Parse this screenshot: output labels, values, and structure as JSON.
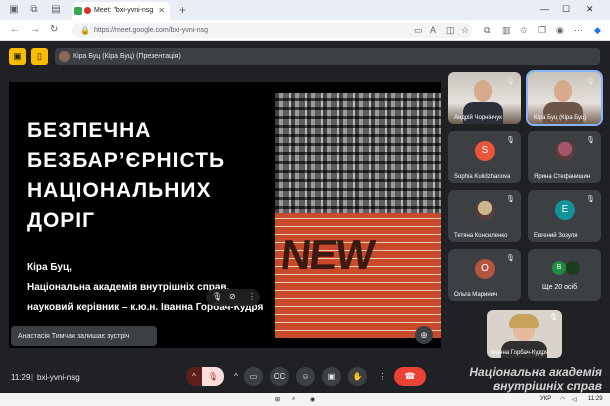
{
  "browser": {
    "tab_title": "Meet: \"bxi-yvni-nsg",
    "url": "https://meet.google.com/bxi-yvni-nsg"
  },
  "meet": {
    "presenter_label": "Кіра Буц (Кіра Буц) (Презентація)",
    "slide": {
      "title": "БЕЗПЕЧНА\nБЕЗБАР’ЄРНІСТЬ\nНАЦІОНАЛЬНИХ\nДОРІГ",
      "author": "Кіра Буц,",
      "affiliation": "Національна академія внутрішніх справ,",
      "supervisor": "науковий керівник – к.ю.н. Іванна Горбач-Кудря",
      "image_text": "NEW"
    },
    "toast": "Анастасія Тимчак залишає зустріч",
    "participants": [
      {
        "name": "Андрій Чорнінчук",
        "kind": "video",
        "color": "#6b5a4c"
      },
      {
        "name": "Кіра Буц (Кіра Буц)",
        "kind": "video",
        "color": "#7a6658"
      },
      {
        "name": "Sophia Kulidzhanova",
        "kind": "avatar",
        "initial": "S",
        "color": "#e8553b"
      },
      {
        "name": "Ярина Стефанишин",
        "kind": "photo",
        "initial": "",
        "color": "#a5566b"
      },
      {
        "name": "Тетяна Консиленко",
        "kind": "photo",
        "initial": "",
        "color": "#c9b88e"
      },
      {
        "name": "Евгений Зозуля",
        "kind": "avatar",
        "initial": "E",
        "color": "#12939a"
      },
      {
        "name": "Ольга Маринич",
        "kind": "avatar",
        "initial": "О",
        "color": "#b3553f"
      },
      {
        "name": "Ще 20 осіб",
        "kind": "more",
        "initial": "B",
        "color": "#1e8e3e"
      }
    ],
    "self_name": "Іванна Горбач-Кудря",
    "clock": "11:29",
    "meeting_code": "bxi-yvni-nsg",
    "watermark_line1": "Національна академія",
    "watermark_line2": "внутрішніх справ"
  },
  "taskbar": {
    "lang": "УКР",
    "time": "11:29"
  }
}
